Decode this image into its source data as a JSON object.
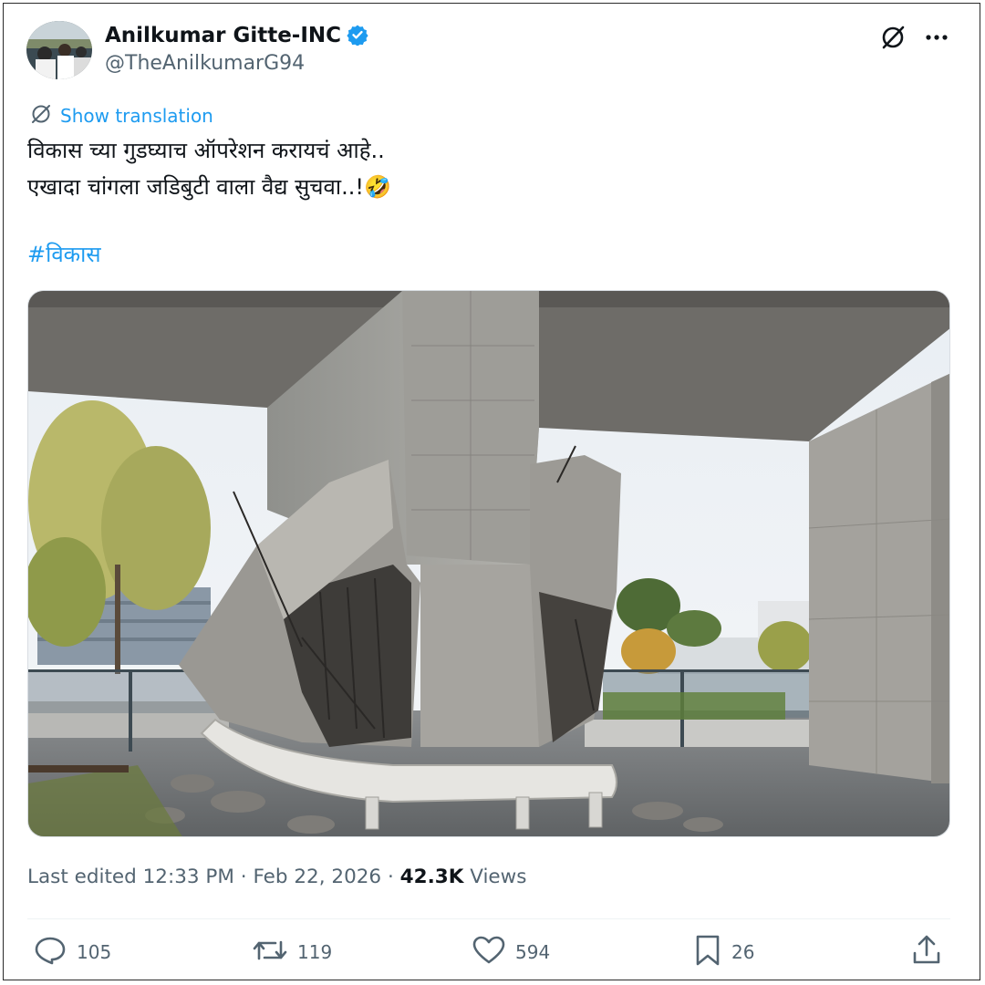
{
  "author": {
    "display_name": "Anilkumar Gitte-INC",
    "handle": "@TheAnilkumarG94",
    "verified": true
  },
  "header_icons": [
    "grok-icon",
    "more-icon"
  ],
  "translate": {
    "icon": "translate-icon",
    "label": "Show translation"
  },
  "tweet": {
    "lines": [
      "विकास च्या गुडघ्याच ऑपरेशन करायचं आहे..",
      "एखादा चांगला जडिबुटी वाला वैद्य सुचवा..!🤣"
    ],
    "hashtag": "#विकास"
  },
  "media": {
    "type": "photo"
  },
  "meta": {
    "edited_label": "Last edited",
    "time": "12:33 PM",
    "date": "Feb 22, 2026",
    "views_count": "42.3K",
    "views_label": "Views"
  },
  "actions": {
    "replies": "105",
    "reposts": "119",
    "likes": "594",
    "bookmarks": "26"
  },
  "colors": {
    "accent": "#1d9bf0",
    "muted": "#536471",
    "text": "#0f1419"
  }
}
